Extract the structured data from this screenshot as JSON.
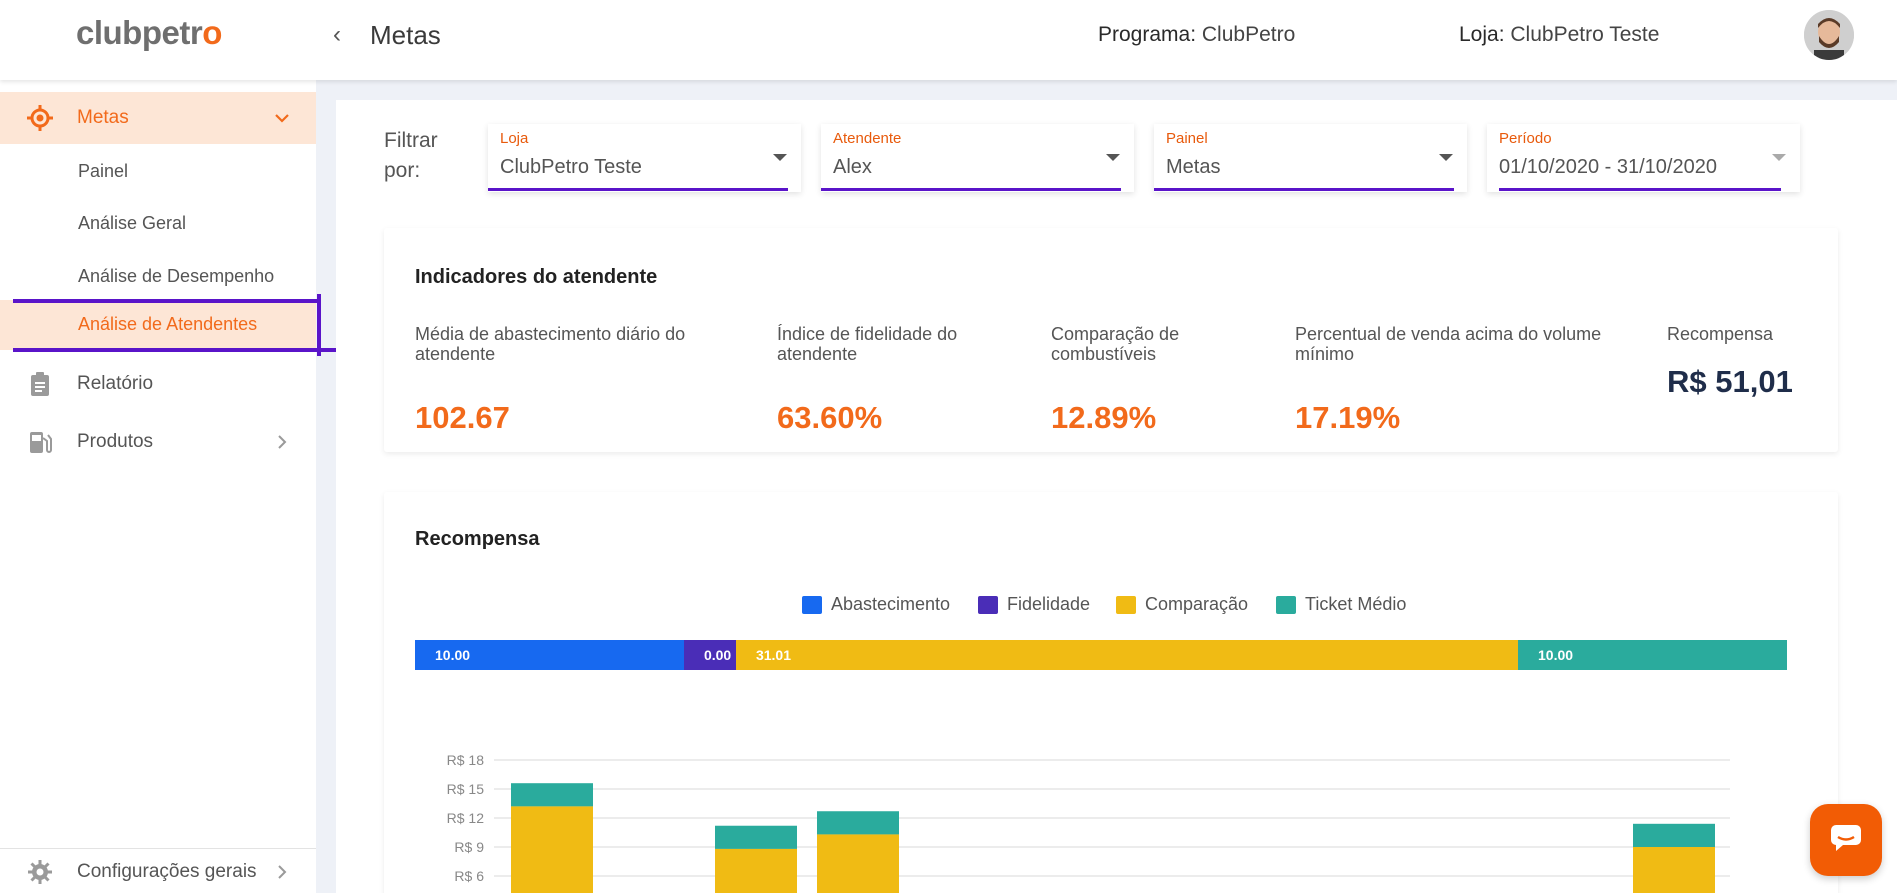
{
  "brand": {
    "logo_main": "clubpetr",
    "logo_accent": "o"
  },
  "header": {
    "back_label": "‹",
    "title": "Metas",
    "programa_label": "Programa:",
    "programa_value": "ClubPetro",
    "loja_label": "Loja:",
    "loja_value": "ClubPetro Teste"
  },
  "sidebar": {
    "metas": "Metas",
    "sub_items": [
      "Painel",
      "Análise Geral",
      "Análise de Desempenho",
      "Análise de Atendentes"
    ],
    "relatorio": "Relatório",
    "produtos": "Produtos",
    "config": "Configurações gerais"
  },
  "filters": {
    "label": "Filtrar por:",
    "dropdowns": [
      {
        "label": "Loja",
        "value": "ClubPetro Teste"
      },
      {
        "label": "Atendente",
        "value": "Alex"
      },
      {
        "label": "Painel",
        "value": "Metas"
      },
      {
        "label": "Período",
        "value": "01/10/2020 - 31/10/2020"
      }
    ]
  },
  "indicators": {
    "title": "Indicadores do atendente",
    "items": [
      {
        "name": "Média de abastecimento diário do atendente",
        "value": "102.67"
      },
      {
        "name": "Índice de fidelidade do atendente",
        "value": "63.60%"
      },
      {
        "name": "Comparação de combustíveis",
        "value": "12.89%"
      },
      {
        "name": "Percentual de venda acima do volume mínimo",
        "value": "17.19%"
      },
      {
        "name": "Recompensa",
        "value": "R$ 51,01"
      }
    ]
  },
  "reward": {
    "title": "Recompensa"
  },
  "colors": {
    "abastecimento": "#1769f0",
    "fidelidade": "#4a2db7",
    "comparacao": "#f0bb14",
    "ticket": "#2aab9d",
    "accent": "#f26a1b"
  },
  "chart_data": [
    {
      "type": "bar",
      "stacked": true,
      "orientation": "horizontal",
      "series": [
        {
          "name": "Abastecimento",
          "values": [
            10.0
          ],
          "label": "10.00"
        },
        {
          "name": "Fidelidade",
          "values": [
            0.0
          ],
          "label": "0.00"
        },
        {
          "name": "Comparação",
          "values": [
            31.01
          ],
          "label": "31.01"
        },
        {
          "name": "Ticket Médio",
          "values": [
            10.0
          ],
          "label": "10.00"
        }
      ],
      "legend_position": "top-center"
    },
    {
      "type": "bar",
      "stacked": true,
      "y_ticks": [
        "R$ 18",
        "R$ 15",
        "R$ 12",
        "R$ 9",
        "R$ 6"
      ],
      "ylim": [
        0,
        18
      ],
      "grid": true,
      "bars": [
        {
          "slot": 0,
          "comparacao": 13.2,
          "ticket": 2.4
        },
        {
          "slot": 2,
          "comparacao": 8.8,
          "ticket": 2.4
        },
        {
          "slot": 3,
          "comparacao": 10.3,
          "ticket": 2.4
        },
        {
          "slot": 11,
          "comparacao": 9.0,
          "ticket": 2.4
        }
      ]
    }
  ]
}
